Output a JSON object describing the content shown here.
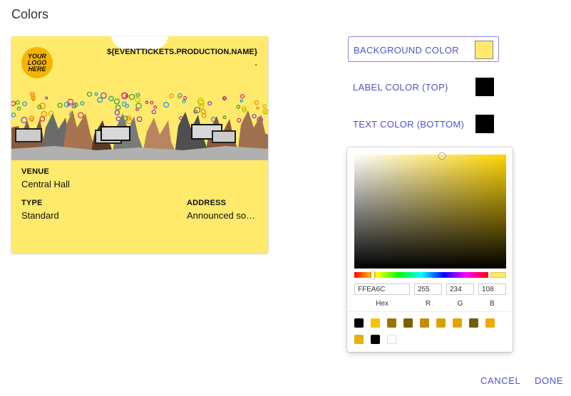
{
  "page": {
    "title": "Colors"
  },
  "ticket": {
    "logo_text": "YOUR LOGO HERE",
    "event_name": "${EVENTTICKETS.PRODUCTION.NAME}",
    "event_subline": "-",
    "venue_label": "VENUE",
    "venue_value": "Central Hall",
    "type_label": "TYPE",
    "type_value": "Standard",
    "address_label": "ADDRESS",
    "address_value": "Announced so…",
    "background": "#ffea6c"
  },
  "color_rows": [
    {
      "label": "BACKGROUND COLOR",
      "color": "#ffea6c",
      "active": true
    },
    {
      "label": "LABEL COLOR (TOP)",
      "color": "#000000",
      "active": false
    },
    {
      "label": "TEXT COLOR (BOTTOM)",
      "color": "#000000",
      "active": false
    }
  ],
  "picker": {
    "hex_value": "FFEA6C",
    "r_value": "255",
    "g_value": "234",
    "b_value": "108",
    "hex_caption": "Hex",
    "r_caption": "R",
    "g_caption": "G",
    "b_caption": "B",
    "current_color": "#ffea6c",
    "presets": [
      "#000000",
      "#f5c400",
      "#9a7400",
      "#7e6000",
      "#c08e00",
      "#d6a400",
      "#e0a600",
      "#6f6010",
      "#f0aa00",
      "#e8b000",
      "#000000",
      "#ffffff"
    ]
  },
  "actions": {
    "cancel": "CANCEL",
    "done": "DONE"
  }
}
